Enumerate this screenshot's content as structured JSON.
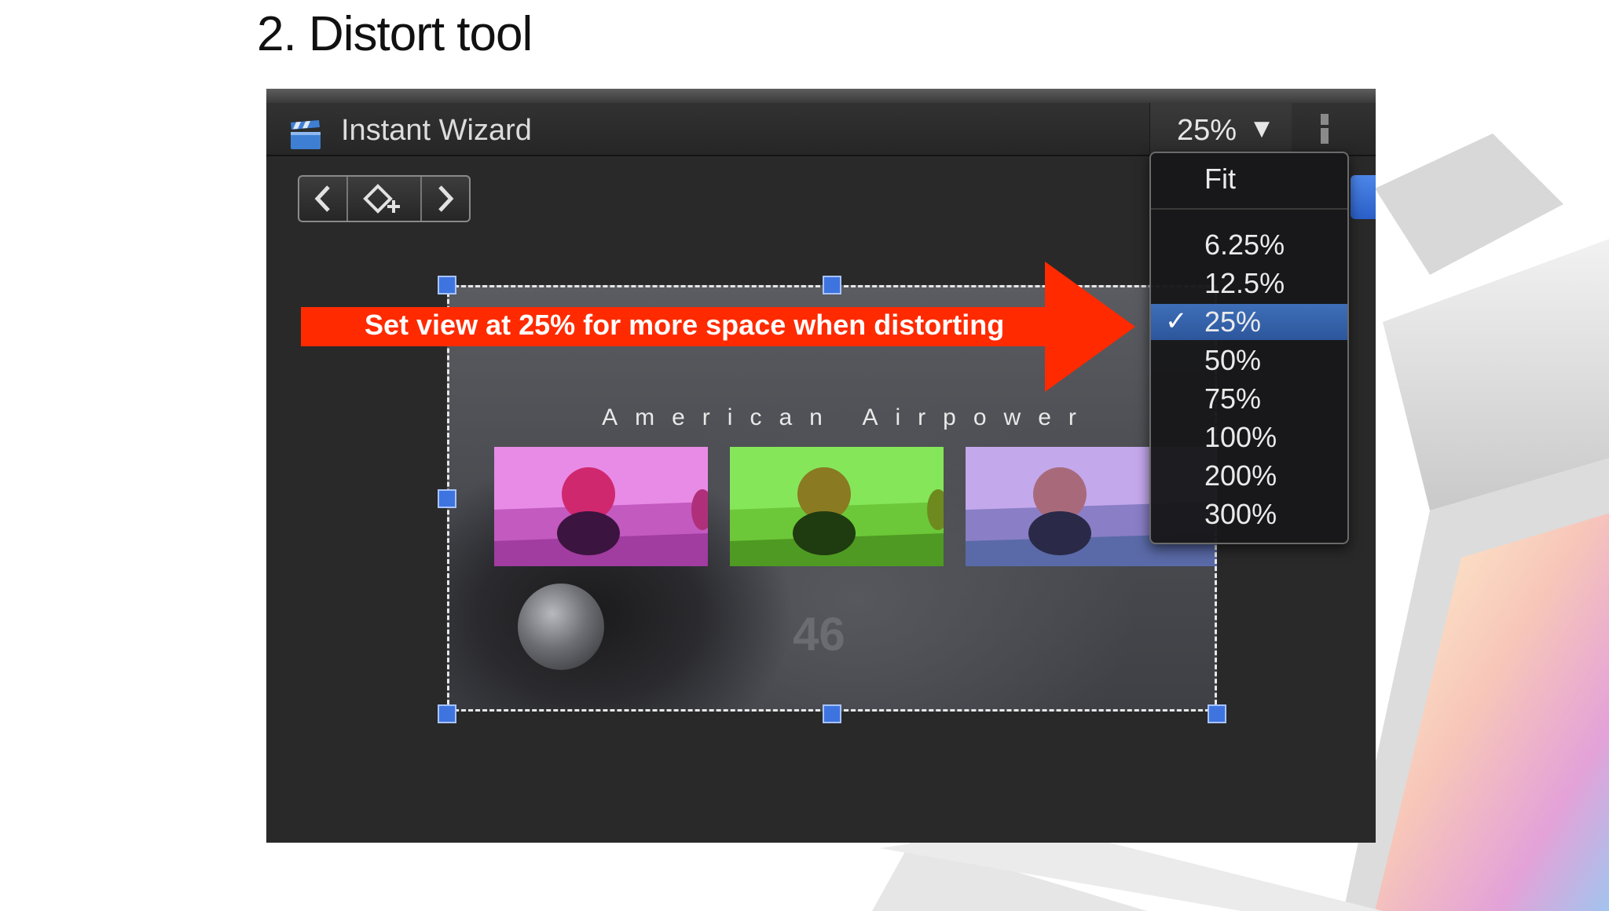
{
  "slide": {
    "title": "2. Distort tool"
  },
  "window": {
    "title": "Instant Wizard",
    "zoom_value": "25%"
  },
  "icons": {
    "clapper": "clapperboard-icon",
    "zoom_caret": "triangle-down-icon",
    "nav_prev": "chevron-left-icon",
    "nav_keyframe": "add-keyframe-icon",
    "nav_next": "chevron-right-icon",
    "checkmark": "checkmark-icon",
    "app_icon": "final-cut-pro-icon"
  },
  "navigation": {
    "prev_glyph": "‹",
    "next_glyph": "›"
  },
  "canvas": {
    "title_text": "American Airpower",
    "overlay_number": "46"
  },
  "zoom_menu": {
    "items": [
      {
        "label": "Fit"
      },
      {
        "label": "6.25%"
      },
      {
        "label": "12.5%"
      },
      {
        "label": "25%",
        "checked": true
      },
      {
        "label": "50%"
      },
      {
        "label": "75%"
      },
      {
        "label": "100%"
      },
      {
        "label": "200%"
      },
      {
        "label": "300%"
      }
    ],
    "check_glyph": "✓"
  },
  "callout": {
    "text": "Set view at 25% for more space when distorting",
    "color": "#ff2a00"
  },
  "colors": {
    "panel_bg": "#292929",
    "handle": "#3e74e0",
    "selected_item": "#2c569c"
  }
}
